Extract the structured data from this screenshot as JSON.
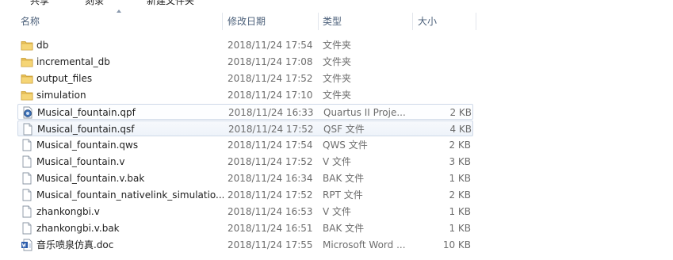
{
  "toolbar": {
    "share_label": "共享",
    "burn_label": "刻录",
    "new_folder_label": "新建文件夹"
  },
  "columns": {
    "name": "名称",
    "date": "修改日期",
    "type": "类型",
    "size": "大小"
  },
  "files": [
    {
      "name": "db",
      "date": "2018/11/24 17:54",
      "type": "文件夹",
      "size": "",
      "icon": "folder-icon",
      "state": ""
    },
    {
      "name": "incremental_db",
      "date": "2018/11/24 17:08",
      "type": "文件夹",
      "size": "",
      "icon": "folder-icon",
      "state": ""
    },
    {
      "name": "output_files",
      "date": "2018/11/24 17:52",
      "type": "文件夹",
      "size": "",
      "icon": "folder-icon",
      "state": ""
    },
    {
      "name": "simulation",
      "date": "2018/11/24 17:10",
      "type": "文件夹",
      "size": "",
      "icon": "folder-icon",
      "state": ""
    },
    {
      "name": "Musical_fountain.qpf",
      "date": "2018/11/24 16:33",
      "type": "Quartus II Proje...",
      "size": "2 KB",
      "icon": "quartus-project-icon",
      "state": "selected"
    },
    {
      "name": "Musical_fountain.qsf",
      "date": "2018/11/24 17:52",
      "type": "QSF 文件",
      "size": "4 KB",
      "icon": "file-icon",
      "state": "hover"
    },
    {
      "name": "Musical_fountain.qws",
      "date": "2018/11/24 17:54",
      "type": "QWS 文件",
      "size": "2 KB",
      "icon": "file-icon",
      "state": ""
    },
    {
      "name": "Musical_fountain.v",
      "date": "2018/11/24 17:52",
      "type": "V 文件",
      "size": "3 KB",
      "icon": "file-icon",
      "state": ""
    },
    {
      "name": "Musical_fountain.v.bak",
      "date": "2018/11/24 16:34",
      "type": "BAK 文件",
      "size": "1 KB",
      "icon": "file-icon",
      "state": ""
    },
    {
      "name": "Musical_fountain_nativelink_simulatio...",
      "date": "2018/11/24 17:52",
      "type": "RPT 文件",
      "size": "2 KB",
      "icon": "file-icon",
      "state": ""
    },
    {
      "name": "zhankongbi.v",
      "date": "2018/11/24 16:53",
      "type": "V 文件",
      "size": "1 KB",
      "icon": "file-icon",
      "state": ""
    },
    {
      "name": "zhankongbi.v.bak",
      "date": "2018/11/24 16:51",
      "type": "BAK 文件",
      "size": "1 KB",
      "icon": "file-icon",
      "state": ""
    },
    {
      "name": "音乐喷泉仿真.doc",
      "date": "2018/11/24 17:55",
      "type": "Microsoft Word ...",
      "size": "10 KB",
      "icon": "word-document-icon",
      "state": ""
    }
  ],
  "colors": {
    "header_text": "#4c607a",
    "folder": "#e8c15a",
    "selection_border": "#cfd9e8",
    "word_blue": "#2a5cab"
  }
}
